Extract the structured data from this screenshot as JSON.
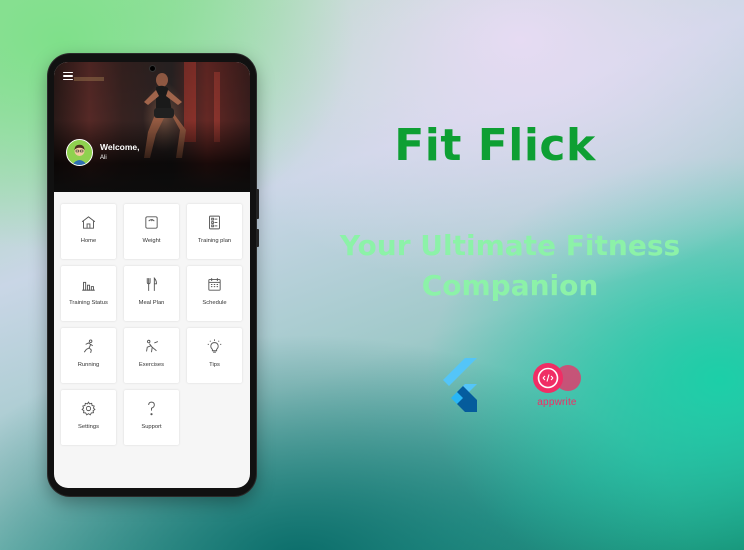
{
  "app": {
    "title": "Fit Flick",
    "tagline_line1": "Your Ultimate Fitness",
    "tagline_line2": "Companion"
  },
  "header": {
    "welcome": "Welcome,",
    "username": "Ali"
  },
  "tiles": [
    {
      "label": "Home",
      "icon": "home-icon"
    },
    {
      "label": "Weight",
      "icon": "scale-icon"
    },
    {
      "label": "Training plan",
      "icon": "checklist-icon"
    },
    {
      "label": "Training Status",
      "icon": "bar-chart-icon"
    },
    {
      "label": "Meal Plan",
      "icon": "utensils-icon"
    },
    {
      "label": "Schedule",
      "icon": "calendar-icon"
    },
    {
      "label": "Running",
      "icon": "runner-icon"
    },
    {
      "label": "Exercises",
      "icon": "exercise-icon"
    },
    {
      "label": "Tips",
      "icon": "lightbulb-icon"
    },
    {
      "label": "Settings",
      "icon": "gear-icon"
    },
    {
      "label": "Support",
      "icon": "question-icon"
    }
  ],
  "logos": {
    "appwrite_text": "appwrite"
  },
  "colors": {
    "title": "#0e9f33",
    "tagline": "#8cf2a8",
    "appwrite": "#f02e65",
    "flutter_light": "#54c5f8",
    "flutter_dark": "#01579b"
  }
}
